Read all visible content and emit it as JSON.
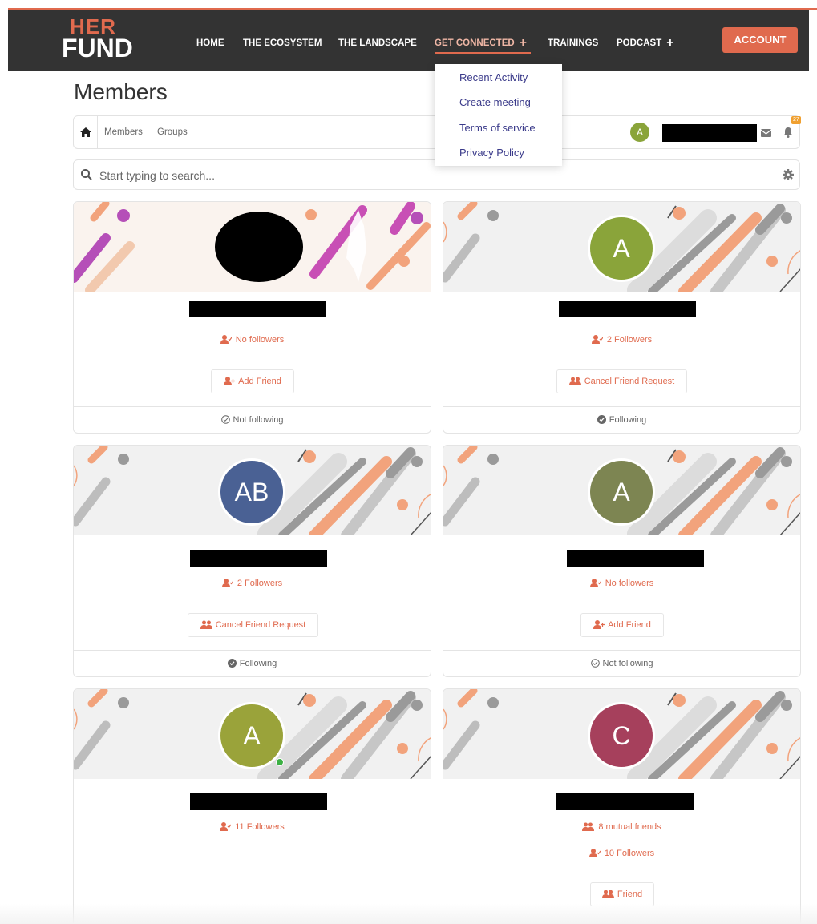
{
  "brand": {
    "top": "HER",
    "bottom": "FUND",
    "accent": "#e06a4e"
  },
  "nav": {
    "home": "HOME",
    "ecosystem": "THE ECOSYSTEM",
    "landscape": "THE LANDSCAPE",
    "get_connected": "GET CONNECTED",
    "trainings": "TRAININGS",
    "podcast": "PODCAST",
    "plus": "+",
    "account": "ACCOUNT"
  },
  "dropdown": {
    "items": [
      "Recent Activity",
      "Create meeting",
      "Terms of service",
      "Privacy Policy"
    ]
  },
  "page": {
    "title": "Members"
  },
  "breadcrumb": {
    "members": "Members",
    "groups": "Groups",
    "user_initial": "A",
    "notification_count": "27"
  },
  "search": {
    "placeholder": "Start typing to search..."
  },
  "cards": [
    {
      "initials": "",
      "followers": "No followers",
      "button": "Add Friend",
      "follow_status": "Not following",
      "avatar_color": "#000000"
    },
    {
      "initials": "A",
      "followers": "2 Followers",
      "button": "Cancel Friend Request",
      "follow_status": "Following",
      "avatar_color": "#8aa43a"
    },
    {
      "initials": "AB",
      "followers": "2 Followers",
      "button": "Cancel Friend Request",
      "follow_status": "Following",
      "avatar_color": "#4a6194"
    },
    {
      "initials": "A",
      "followers": "No followers",
      "button": "Add Friend",
      "follow_status": "Not following",
      "avatar_color": "#7d8552"
    },
    {
      "initials": "A",
      "followers": "11 Followers",
      "avatar_color": "#9aa33a"
    },
    {
      "initials": "C",
      "mutual": "8 mutual friends",
      "followers": "10 Followers",
      "button": "Friend",
      "avatar_color": "#a6405c"
    }
  ]
}
